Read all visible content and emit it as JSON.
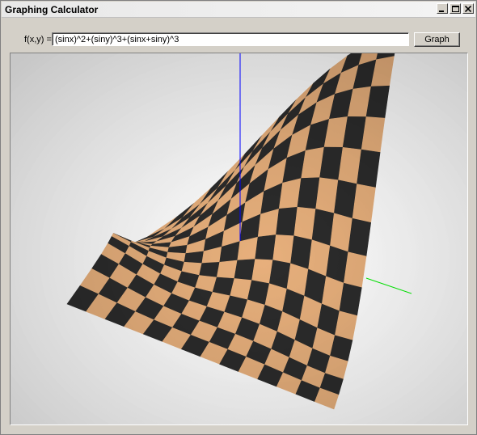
{
  "window": {
    "title": "Graphing Calculator",
    "controls": [
      "minimize-icon",
      "maximize-icon",
      "close-icon"
    ]
  },
  "formula": {
    "label": "f(x,y) =",
    "value": "(sinx)^2+(siny)^3+(sinx+siny)^3"
  },
  "graph_button": {
    "label": "Graph"
  },
  "plot": {
    "surface_colors": {
      "light": "#e8b07c",
      "dark": "#2b2b2b"
    },
    "axis_colors": {
      "z": "#0000ff",
      "x": "#00dd00"
    },
    "background": "#ffffff"
  }
}
